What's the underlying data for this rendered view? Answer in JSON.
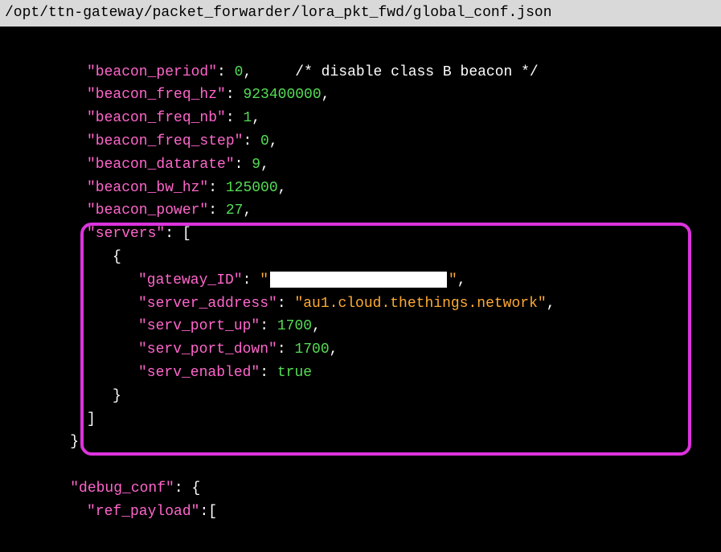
{
  "filepath": "/opt/ttn-gateway/packet_forwarder/lora_pkt_fwd/global_conf.json",
  "config": {
    "beacon_period": {
      "key": "\"beacon_period\"",
      "val": "0",
      "comment": "/* disable class B beacon */"
    },
    "beacon_freq_hz": {
      "key": "\"beacon_freq_hz\"",
      "val": "923400000"
    },
    "beacon_freq_nb": {
      "key": "\"beacon_freq_nb\"",
      "val": "1"
    },
    "beacon_freq_step": {
      "key": "\"beacon_freq_step\"",
      "val": "0"
    },
    "beacon_datarate": {
      "key": "\"beacon_datarate\"",
      "val": "9"
    },
    "beacon_bw_hz": {
      "key": "\"beacon_bw_hz\"",
      "val": "125000"
    },
    "beacon_power": {
      "key": "\"beacon_power\"",
      "val": "27"
    },
    "servers_key": "\"servers\"",
    "gateway_ID": {
      "key": "\"gateway_ID\"",
      "quote": "\""
    },
    "server_address": {
      "key": "\"server_address\"",
      "val": "\"au1.cloud.thethings.network\""
    },
    "serv_port_up": {
      "key": "\"serv_port_up\"",
      "val": "1700"
    },
    "serv_port_down": {
      "key": "\"serv_port_down\"",
      "val": "1700"
    },
    "serv_enabled": {
      "key": "\"serv_enabled\"",
      "val": "true"
    },
    "debug_conf_key": "\"debug_conf\"",
    "ref_payload_key": "\"ref_payload\""
  },
  "punct": {
    "colon": ":",
    "comma": ",",
    "colon_space": ": ",
    "open_bracket": "[",
    "close_bracket": "]",
    "open_brace": "{",
    "close_brace": "}",
    "close_brace_comma": "},"
  }
}
